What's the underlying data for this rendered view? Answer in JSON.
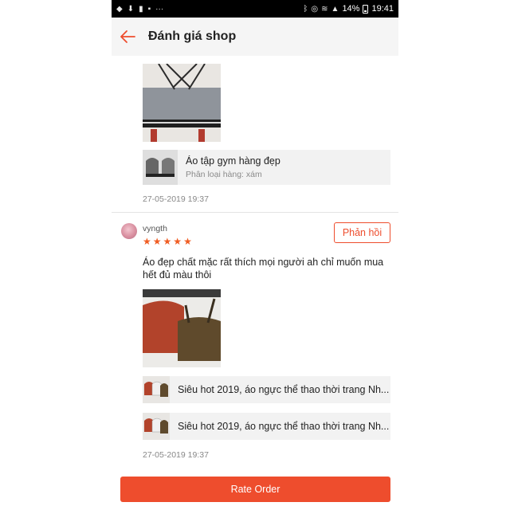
{
  "status_bar": {
    "time": "19:41",
    "battery": "14%",
    "dots": "···"
  },
  "header": {
    "title": "Đánh giá shop"
  },
  "review1": {
    "product": {
      "name": "Áo tập gym hàng đẹp",
      "variant": "Phân loại hàng: xám"
    },
    "date": "27-05-2019 19:37"
  },
  "review2": {
    "username": "vyngth",
    "rating": 5,
    "reply_label": "Phản hồi",
    "comment": "Áo đẹp chất mặc rất thích mọi người ah chỉ muốn mua hết đủ màu thôi",
    "products": [
      {
        "name": "Siêu hot 2019, áo ngực thể thao thời trang Nh..."
      },
      {
        "name": "Siêu hot 2019, áo ngực thể thao thời trang Nh..."
      }
    ],
    "date": "27-05-2019 19:37"
  },
  "footer": {
    "rate_label": "Rate Order"
  },
  "colors": {
    "accent": "#ee4d2d",
    "star": "#f05d23",
    "header_bg": "#f5f5f5"
  }
}
